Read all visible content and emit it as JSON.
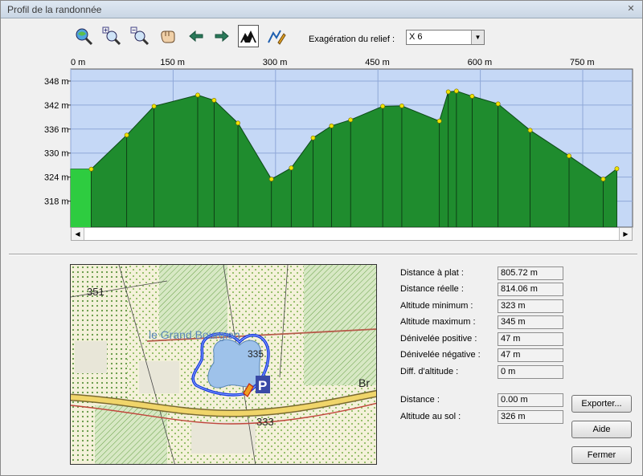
{
  "window": {
    "title": "Profil de la randonnée",
    "close_glyph": "✕"
  },
  "toolbar": {
    "tools": [
      {
        "icon": "zoom-all-icon"
      },
      {
        "icon": "zoom-in-icon"
      },
      {
        "icon": "zoom-out-icon"
      },
      {
        "icon": "pan-hand-icon"
      },
      {
        "icon": "arrow-left-icon"
      },
      {
        "icon": "arrow-right-icon"
      },
      {
        "icon": "relief-mountain-icon",
        "active": true
      },
      {
        "icon": "profile-pencil-icon"
      }
    ],
    "exaggeration_label": "Exagération du relief :",
    "exaggeration_value": "X 6"
  },
  "chart_data": {
    "type": "area",
    "x_ticks": [
      "0 m",
      "150 m",
      "300 m",
      "450 m",
      "600 m",
      "750 m"
    ],
    "x_tick_values": [
      0,
      150,
      300,
      450,
      600,
      750
    ],
    "y_ticks": [
      "348 m",
      "342 m",
      "336 m",
      "330 m",
      "324 m",
      "318 m"
    ],
    "y_tick_values": [
      348,
      342,
      336,
      330,
      324,
      318
    ],
    "xlim": [
      0,
      823
    ],
    "ylim": [
      311.5,
      351
    ],
    "x": [
      0,
      30,
      82,
      122,
      186,
      210,
      245,
      294,
      323,
      355,
      382,
      410,
      457,
      485,
      540,
      553,
      565,
      588,
      626,
      673,
      730,
      780,
      800
    ],
    "y": [
      326,
      326,
      334.5,
      341.7,
      344.5,
      343.2,
      337.5,
      323.5,
      326.3,
      333.8,
      336.8,
      338.3,
      341.7,
      341.8,
      338,
      345.3,
      345.5,
      344.2,
      342.3,
      335.7,
      329.3,
      323.5,
      326.1
    ],
    "start_marker_x": 30,
    "colors": {
      "fill": "#1f8c2e",
      "sky": "#c5d8f6",
      "grid": "#8fa8d8",
      "marker": "#f0e400",
      "start": "#2ecc40"
    }
  },
  "map": {
    "labels": [
      {
        "text": "351"
      },
      {
        "text": "le Grand Bourgien"
      },
      {
        "text": "335"
      },
      {
        "text": "333"
      },
      {
        "text": "Br"
      },
      {
        "text": "P"
      }
    ]
  },
  "stats": [
    {
      "label": "Distance à plat :",
      "value": "805.72 m"
    },
    {
      "label": "Distance réelle :",
      "value": "814.06 m"
    },
    {
      "label": "Altitude minimum :",
      "value": "323 m"
    },
    {
      "label": "Altitude maximum :",
      "value": "345 m"
    },
    {
      "label": "Dénivelée positive :",
      "value": "47 m"
    },
    {
      "label": "Dénivelée négative :",
      "value": "47 m"
    },
    {
      "label": "Diff. d'altitude :",
      "value": "0 m"
    }
  ],
  "cursor": [
    {
      "label": "Distance :",
      "value": "0.00 m"
    },
    {
      "label": "Altitude au sol :",
      "value": "326 m"
    }
  ],
  "buttons": {
    "export": "Exporter...",
    "help": "Aide",
    "close": "Fermer"
  }
}
